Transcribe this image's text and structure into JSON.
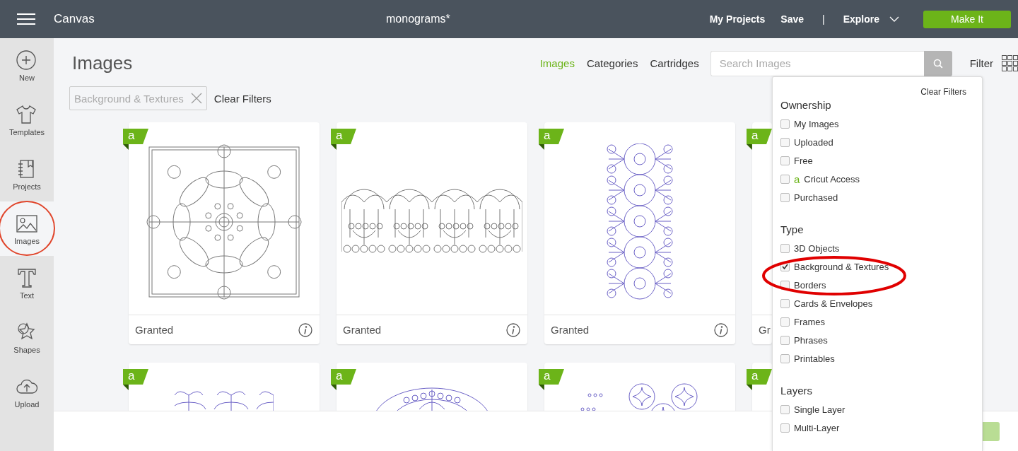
{
  "topbar": {
    "app_title": "Canvas",
    "project_title": "monograms*",
    "links": [
      "My Projects",
      "Save"
    ],
    "separator": "|",
    "explore": "Explore",
    "make_it": "Make It"
  },
  "sidebar": {
    "items": [
      {
        "label": "New",
        "selected": false
      },
      {
        "label": "Templates",
        "selected": false
      },
      {
        "label": "Projects",
        "selected": false
      },
      {
        "label": "Images",
        "selected": true
      },
      {
        "label": "Text",
        "selected": false
      },
      {
        "label": "Shapes",
        "selected": false
      },
      {
        "label": "Upload",
        "selected": false
      }
    ]
  },
  "header": {
    "title": "Images",
    "tabs": [
      {
        "label": "Images",
        "selected": true
      },
      {
        "label": "Categories",
        "selected": false
      },
      {
        "label": "Cartridges",
        "selected": false
      }
    ],
    "search": {
      "placeholder": "Search Images"
    },
    "filter": "Filter"
  },
  "active_filters": {
    "chips": [
      "Background & Textures"
    ],
    "clear": "Clear Filters"
  },
  "cards": [
    {
      "badge": "a",
      "label": "Granted"
    },
    {
      "badge": "a",
      "label": "Granted"
    },
    {
      "badge": "a",
      "label": "Granted"
    },
    {
      "badge": "a",
      "label": "Gr"
    },
    {
      "badge": "a"
    },
    {
      "badge": "a"
    },
    {
      "badge": "a"
    },
    {
      "badge": "a"
    }
  ],
  "filter_panel": {
    "clear": "Clear Filters",
    "sections": [
      {
        "title": "Ownership",
        "options": [
          {
            "label": "My Images",
            "checked": false
          },
          {
            "label": "Uploaded",
            "checked": false
          },
          {
            "label": "Free",
            "checked": false
          },
          {
            "label": "Cricut Access",
            "checked": false,
            "badge": "a"
          },
          {
            "label": "Purchased",
            "checked": false
          }
        ]
      },
      {
        "title": "Type",
        "options": [
          {
            "label": "3D Objects",
            "checked": false
          },
          {
            "label": "Background & Textures",
            "checked": true
          },
          {
            "label": "Borders",
            "checked": false
          },
          {
            "label": "Cards & Envelopes",
            "checked": false
          },
          {
            "label": "Frames",
            "checked": false
          },
          {
            "label": "Phrases",
            "checked": false
          },
          {
            "label": "Printables",
            "checked": false
          }
        ]
      },
      {
        "title": "Layers",
        "options": [
          {
            "label": "Single Layer",
            "checked": false
          },
          {
            "label": "Multi-Layer",
            "checked": false
          }
        ]
      }
    ]
  }
}
